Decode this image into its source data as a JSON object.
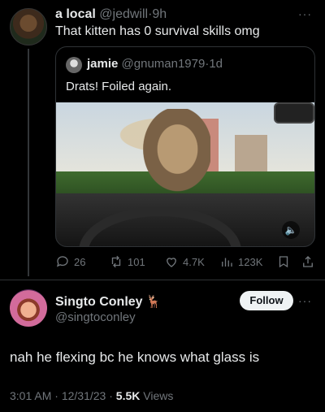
{
  "post1": {
    "display_name": "a local",
    "handle": "@jedwill",
    "separator": "·",
    "time": "9h",
    "text": "That kitten has 0 survival skills omg",
    "more": "···"
  },
  "quote": {
    "display_name": "jamie",
    "handle": "@gnuman1979",
    "separator": "·",
    "time": "1d",
    "text": "Drats! Foiled again.",
    "video_sound_icon": "speaker-icon"
  },
  "actions": {
    "replies": "26",
    "reposts": "101",
    "likes": "4.7K",
    "views": "123K"
  },
  "post2": {
    "display_name": "Singto Conley",
    "emoji": "🦌",
    "handle": "@singtoconley",
    "follow_label": "Follow",
    "more": "···",
    "text": "nah he flexing bc he knows what glass is",
    "time": "3:01 AM",
    "date": "12/31/23",
    "views_count": "5.5K",
    "views_label": "Views",
    "sep": "·"
  },
  "colors": {
    "background": "#000000",
    "text": "#e7e9ea",
    "muted": "#71767b",
    "border": "#2f3336",
    "follow_bg": "#eff3f4"
  }
}
